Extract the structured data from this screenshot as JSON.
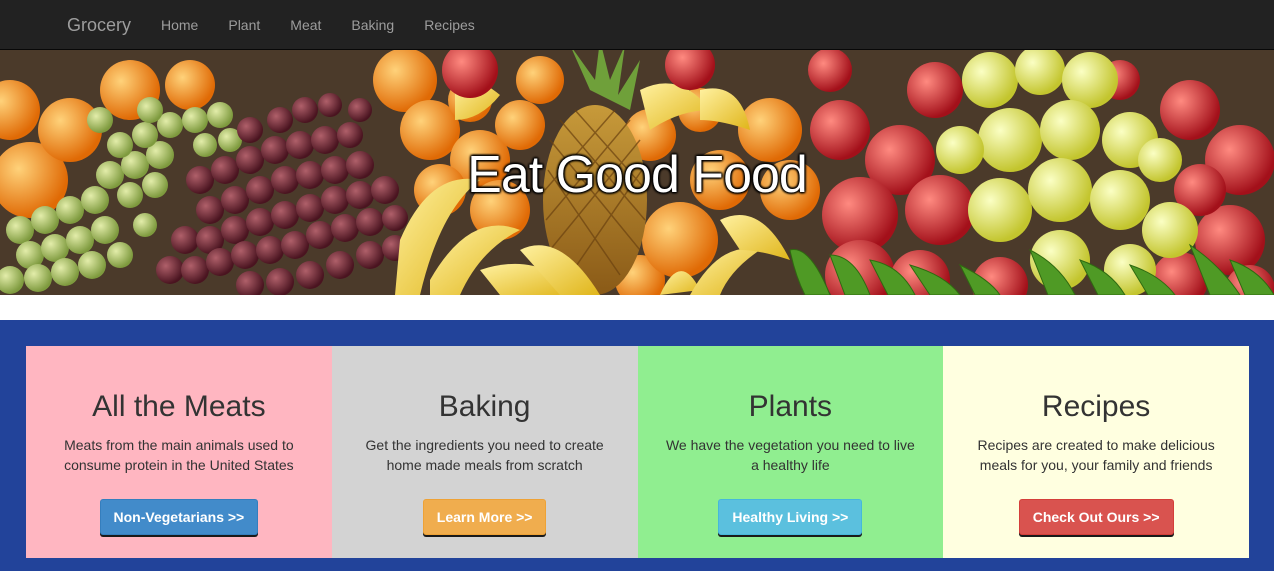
{
  "navbar": {
    "brand": "Grocery",
    "links": [
      "Home",
      "Plant",
      "Meat",
      "Baking",
      "Recipes"
    ]
  },
  "hero": {
    "title": "Eat Good Food"
  },
  "cards": [
    {
      "title": "All the Meats",
      "text": "Meats from the main animals used to consume protein in the United States",
      "button": "Non-Vegetarians >>",
      "bg": "#ffb6c1",
      "button_color": "#428bca"
    },
    {
      "title": "Baking",
      "text": "Get the ingredients you need to create home made meals from scratch",
      "button": "Learn More >>",
      "bg": "#d3d3d3",
      "button_color": "#f0ad4e"
    },
    {
      "title": "Plants",
      "text": "We have the vegetation you need to live a healthy life",
      "button": "Healthy Living >>",
      "bg": "#90ee90",
      "button_color": "#5bc0de"
    },
    {
      "title": "Recipes",
      "text": "Recipes are created to make delicious meals for you, your family and friends",
      "button": "Check Out Ours >>",
      "bg": "#ffffe0",
      "button_color": "#d9534f"
    }
  ],
  "colors": {
    "navbar_bg": "#222222",
    "features_bg": "#22439a"
  }
}
